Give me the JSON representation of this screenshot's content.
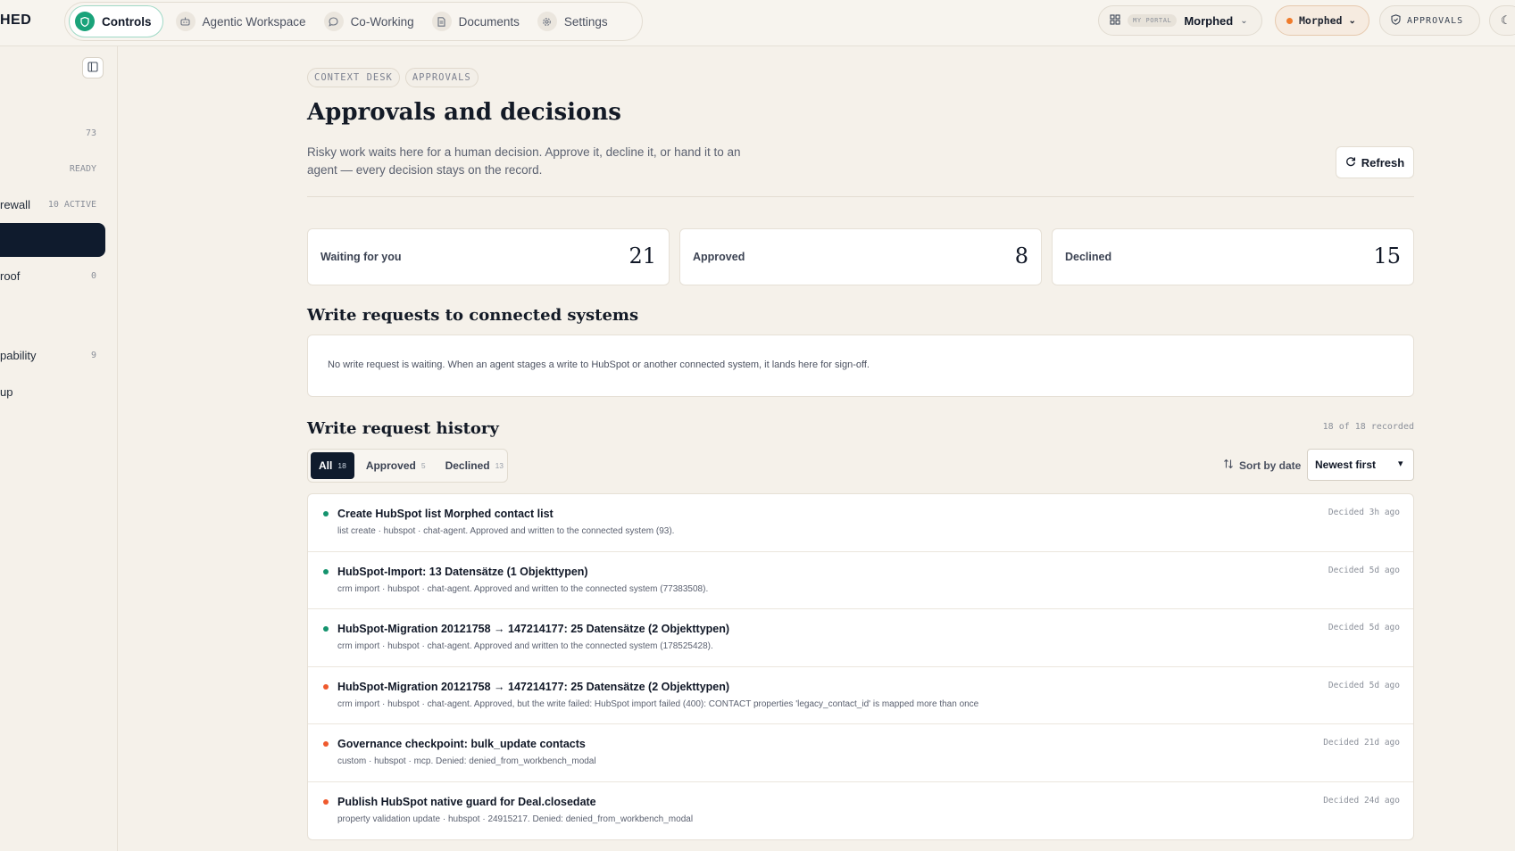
{
  "brand": "HED",
  "nav": {
    "items": [
      {
        "label": "Controls",
        "icon": "shield-icon",
        "active": true
      },
      {
        "label": "Agentic Workspace",
        "icon": "robot-icon"
      },
      {
        "label": "Co-Working",
        "icon": "chat-icon"
      },
      {
        "label": "Documents",
        "icon": "document-icon"
      },
      {
        "label": "Settings",
        "icon": "gear-icon"
      }
    ]
  },
  "header": {
    "portal_tag": "MY PORTAL",
    "portal_name": "Morphed",
    "workspace_label": "Morphed",
    "approvals_label": "APPROVALS"
  },
  "sidebar": {
    "rows": [
      {
        "label": "",
        "meta": "73"
      },
      {
        "label": "",
        "meta": "READY"
      },
      {
        "label": "rewall",
        "meta": "10 ACTIVE"
      },
      {
        "label": "",
        "meta": ""
      },
      {
        "label": "roof",
        "meta": "0"
      },
      {
        "label": "pability",
        "meta": "9"
      },
      {
        "label": "up",
        "meta": ""
      }
    ]
  },
  "page": {
    "crumbs": [
      "CONTEXT DESK",
      "APPROVALS"
    ],
    "title": "Approvals and decisions",
    "description": "Risky work waits here for a human decision. Approve it, decline it, or hand it to an agent — every decision stays on the record.",
    "refresh_label": "Refresh"
  },
  "stats": [
    {
      "label": "Waiting for you",
      "value": "21"
    },
    {
      "label": "Approved",
      "value": "8"
    },
    {
      "label": "Declined",
      "value": "15"
    }
  ],
  "write_requests": {
    "title": "Write requests to connected systems",
    "empty_text": "No write request is waiting. When an agent stages a write to HubSpot or another connected system, it lands here for sign-off."
  },
  "history": {
    "title": "Write request history",
    "recorded": "18 of 18 recorded",
    "filters": [
      {
        "label": "All",
        "count": "18",
        "active": true
      },
      {
        "label": "Approved",
        "count": "5"
      },
      {
        "label": "Declined",
        "count": "13"
      }
    ],
    "sort_label": "Sort by date",
    "sort_value": "Newest first",
    "colors": {
      "approved": "#15936e",
      "declined": "#ef5a2e"
    },
    "items": [
      {
        "title": "Create HubSpot list Morphed contact list",
        "sub": "list create · hubspot · chat-agent. Approved and written to the connected system (93).",
        "when": "Decided 3h ago",
        "status": "approved"
      },
      {
        "title": "HubSpot-Import: 13 Datensätze (1 Objekttypen)",
        "sub": "crm import · hubspot · chat-agent. Approved and written to the connected system (77383508).",
        "when": "Decided 5d ago",
        "status": "approved"
      },
      {
        "title": "HubSpot-Migration 20121758 → 147214177: 25 Datensätze (2 Objekttypen)",
        "sub": "crm import · hubspot · chat-agent. Approved and written to the connected system (178525428).",
        "when": "Decided 5d ago",
        "status": "approved"
      },
      {
        "title": "HubSpot-Migration 20121758 → 147214177: 25 Datensätze (2 Objekttypen)",
        "sub": "crm import · hubspot · chat-agent. Approved, but the write failed: HubSpot import failed (400): CONTACT properties 'legacy_contact_id' is mapped more than once",
        "when": "Decided 5d ago",
        "status": "declined"
      },
      {
        "title": "Governance checkpoint: bulk_update contacts",
        "sub": "custom · hubspot · mcp. Denied: denied_from_workbench_modal",
        "when": "Decided 21d ago",
        "status": "declined"
      },
      {
        "title": "Publish HubSpot native guard for Deal.closedate",
        "sub": "property validation update · hubspot · 24915217. Denied: denied_from_workbench_modal",
        "when": "Decided 24d ago",
        "status": "declined"
      }
    ]
  }
}
